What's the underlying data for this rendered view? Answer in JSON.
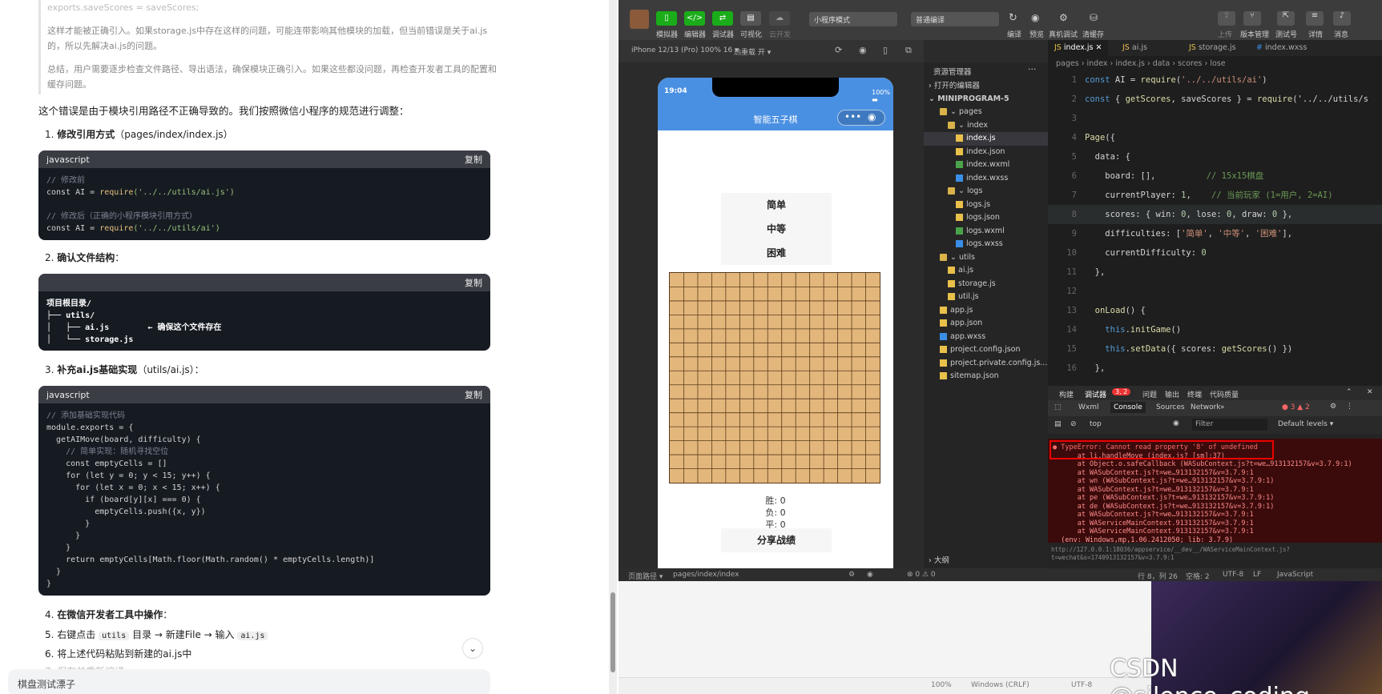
{
  "article": {
    "quote_p1": "exports.saveScores = saveScores;",
    "quote_p2": "这样才能被正确引入。如果storage.js中存在这样的问题，可能连带影响其他模块的加载，但当前错误是关于ai.js的，所以先解决ai.js的问题。",
    "quote_p3": "总结，用户需要逐步检查文件路径、导出语法，确保模块正确引入。如果这些都没问题，再检查开发者工具的配置和缓存问题。",
    "intro": "这个错误是由于模块引用路径不正确导致的。我们按照微信小程序的规范进行调整：",
    "step1_title": "修改引用方式",
    "step1_path": "（pages/index/index.js）",
    "step2_title": "确认文件结构",
    "step2_colon": "：",
    "step3_title": "补充ai.js基础实现",
    "step3_path": "（utils/ai.js）：",
    "step4": "在微信开发者工具中操作",
    "step4_colon": "：",
    "step5_a": "右键点击",
    "step5_code1": "utils",
    "step5_b": "目录 → 新建File → 输入",
    "step5_code2": "ai.js",
    "step6": "将上述代码粘贴到新建的ai.js中",
    "step7": "保存并重新编译",
    "n1": "1.",
    "n2": "2.",
    "n3": "3.",
    "n4": "4.",
    "n5": "5.",
    "n6": "6.",
    "n7": "7.",
    "code1_lang": "javascript",
    "code1_copy": "复制",
    "code1_l1": "// 修改前",
    "code1_l2a": "const AI = ",
    "code1_l2b": "require",
    "code1_l2c": "('../../utils/ai.js')",
    "code1_l3": "// 修改后（正确的小程序模块引用方式）",
    "code1_l4a": "const AI = ",
    "code1_l4b": "require",
    "code1_l4c": "('../../utils/ai')",
    "code2_copy": "复制",
    "code2_l1": "项目根目录/",
    "code2_l2": "├── utils/",
    "code2_l3": "│   ├── ai.js        ← 确保这个文件存在",
    "code2_l4": "│   └── storage.js",
    "code3_lang": "javascript",
    "code3_copy": "复制",
    "code3_lines": [
      "// 添加基础实现代码",
      "module.exports = {",
      "  getAIMove(board, difficulty) {",
      "    // 简单实现：随机寻找空位",
      "    const emptyCells = []",
      "    for (let y = 0; y < 15; y++) {",
      "      for (let x = 0; x < 15; x++) {",
      "        if (board[y][x] === 0) {",
      "          emptyCells.push({x, y})",
      "        }",
      "      }",
      "    }",
      "    return emptyCells[Math.floor(Math.random() * emptyCells.length)]",
      "  }",
      "}"
    ],
    "bottom_input": "棋盘测试漂子",
    "expand_icon": "⌄"
  },
  "ide": {
    "toolbar_labels": [
      "模拟器",
      "编辑器",
      "调试器",
      "可视化",
      "云开发"
    ],
    "mode_dropdown": "小程序模式",
    "compile_dropdown": "普通编译",
    "toolbar_right_labels": [
      "编译",
      "预览",
      "真机调试",
      "清缓存"
    ],
    "toolbar_far_labels": [
      "上传",
      "版本管理",
      "测试号",
      "详情",
      "消息"
    ],
    "device": "iPhone 12/13 (Pro) 100% 16 ▾",
    "hotreload": "热重载 开 ▾",
    "phone_time": "19:04",
    "phone_battery": "100%",
    "phone_title": "智能五子棋",
    "capsule_dots": "•••",
    "capsule_circle": "◉",
    "difficulty_easy": "简单",
    "difficulty_mid": "中等",
    "difficulty_hard": "困难",
    "score_win": "胜: 0",
    "score_lose": "负: 0",
    "score_draw": "平: 0",
    "share_button": "分享战绩",
    "explorer_title": "资源管理器",
    "open_editors": "打开的编辑器",
    "project_name": "MINIPROGRAM-5",
    "outline": "大纲",
    "tree": [
      {
        "name": "pages",
        "depth": 1,
        "type": "folder"
      },
      {
        "name": "index",
        "depth": 2,
        "type": "folder"
      },
      {
        "name": "index.js",
        "depth": 3,
        "type": "js",
        "active": true
      },
      {
        "name": "index.json",
        "depth": 3,
        "type": "json"
      },
      {
        "name": "index.wxml",
        "depth": 3,
        "type": "wxml"
      },
      {
        "name": "index.wxss",
        "depth": 3,
        "type": "wxss"
      },
      {
        "name": "logs",
        "depth": 2,
        "type": "folder"
      },
      {
        "name": "logs.js",
        "depth": 3,
        "type": "js"
      },
      {
        "name": "logs.json",
        "depth": 3,
        "type": "json"
      },
      {
        "name": "logs.wxml",
        "depth": 3,
        "type": "wxml"
      },
      {
        "name": "logs.wxss",
        "depth": 3,
        "type": "wxss"
      },
      {
        "name": "utils",
        "depth": 1,
        "type": "folder"
      },
      {
        "name": "ai.js",
        "depth": 2,
        "type": "js"
      },
      {
        "name": "storage.js",
        "depth": 2,
        "type": "js"
      },
      {
        "name": "util.js",
        "depth": 2,
        "type": "js"
      },
      {
        "name": "app.js",
        "depth": 1,
        "type": "js"
      },
      {
        "name": "app.json",
        "depth": 1,
        "type": "json"
      },
      {
        "name": "app.wxss",
        "depth": 1,
        "type": "wxss"
      },
      {
        "name": "project.config.json",
        "depth": 1,
        "type": "json"
      },
      {
        "name": "project.private.config.js...",
        "depth": 1,
        "type": "json"
      },
      {
        "name": "sitemap.json",
        "depth": 1,
        "type": "json"
      }
    ],
    "tabs": [
      "index.js",
      "ai.js",
      "storage.js",
      "index.wxss"
    ],
    "breadcrumb": "pages › index › index.js › data › scores › lose",
    "code_lines": [
      {
        "n": "1",
        "t": "const AI = require('../../utils/ai')"
      },
      {
        "n": "2",
        "t": "const { getScores, saveScores } = require('../../utils/s"
      },
      {
        "n": "3",
        "t": ""
      },
      {
        "n": "4",
        "t": "Page({"
      },
      {
        "n": "5",
        "t": "  data: {"
      },
      {
        "n": "6",
        "t": "    board: [],          // 15x15棋盘"
      },
      {
        "n": "7",
        "t": "    currentPlayer: 1,    // 当前玩家 (1=用户, 2=AI)"
      },
      {
        "n": "8",
        "t": "    scores: { win: 0, lose: 0, draw: 0 },"
      },
      {
        "n": "9",
        "t": "    difficulties: ['简单', '中等', '困难'],"
      },
      {
        "n": "10",
        "t": "    currentDifficulty: 0"
      },
      {
        "n": "11",
        "t": "  },"
      },
      {
        "n": "12",
        "t": ""
      },
      {
        "n": "13",
        "t": "  onLoad() {"
      },
      {
        "n": "14",
        "t": "    this.initGame()"
      },
      {
        "n": "15",
        "t": "    this.setData({ scores: getScores() })"
      },
      {
        "n": "16",
        "t": "  },"
      }
    ],
    "devtools_tabs": [
      "构建",
      "调试器",
      "问题",
      "输出",
      "终端",
      "代码质量"
    ],
    "devtools_badge": "3, 2",
    "console_tabs": [
      "Wxml",
      "Console",
      "Sources",
      "Network",
      "»"
    ],
    "err_counts": "● 3  ▲ 2",
    "ctx_top": "top",
    "filter": "Filter",
    "levels": "Default levels ▾",
    "error_lines": [
      "● TypeError: Cannot read property '8' of undefined",
      "      at li.handleMove (index.js? [sm]:37)",
      "      at Object.o.safeCallback (WASubContext.js?t=we…913132157&v=3.7.9:1)",
      "      at WASubContext.js?t=we…913132157&v=3.7.9:1",
      "      at wn (WASubContext.js?t=we…913132157&v=3.7.9:1)",
      "      at WASubContext.js?t=we…913132157&v=3.7.9:1",
      "      at pe (WASubContext.js?t=we…913132157&v=3.7.9:1)",
      "      at de (WASubContext.js?t=we…913132157&v=3.7.9:1)",
      "      at WASubContext.js?t=we…913132157&v=3.7.9:1",
      "      at WAServiceMainContext.913132157&v=3.7.9:1",
      "      at WAServiceMainContext.913132157&v=3.7.9:1",
      "  (env: Windows,mp,1.06.2412050; lib: 3.7.9)"
    ],
    "url_line": "http://127.0.0.1:18036/appservice/__dev__/WAServiceMainContext.js?t=wechat&s=1740913132157&v=3.7.9:1",
    "page_path_label": "页面路径 ▾",
    "page_path": "pages/index/index",
    "err_summary": "⊗ 0 ⚠ 0",
    "cursor_pos": "行 8，列 26",
    "spaces": "空格: 2",
    "encoding": "UTF-8",
    "eol": "LF",
    "language": "JavaScript",
    "desk_zoom": "100%",
    "desk_eol": "Windows (CRLF)",
    "desk_enc": "UTF-8"
  },
  "watermark": "CSDN @silence_coding"
}
